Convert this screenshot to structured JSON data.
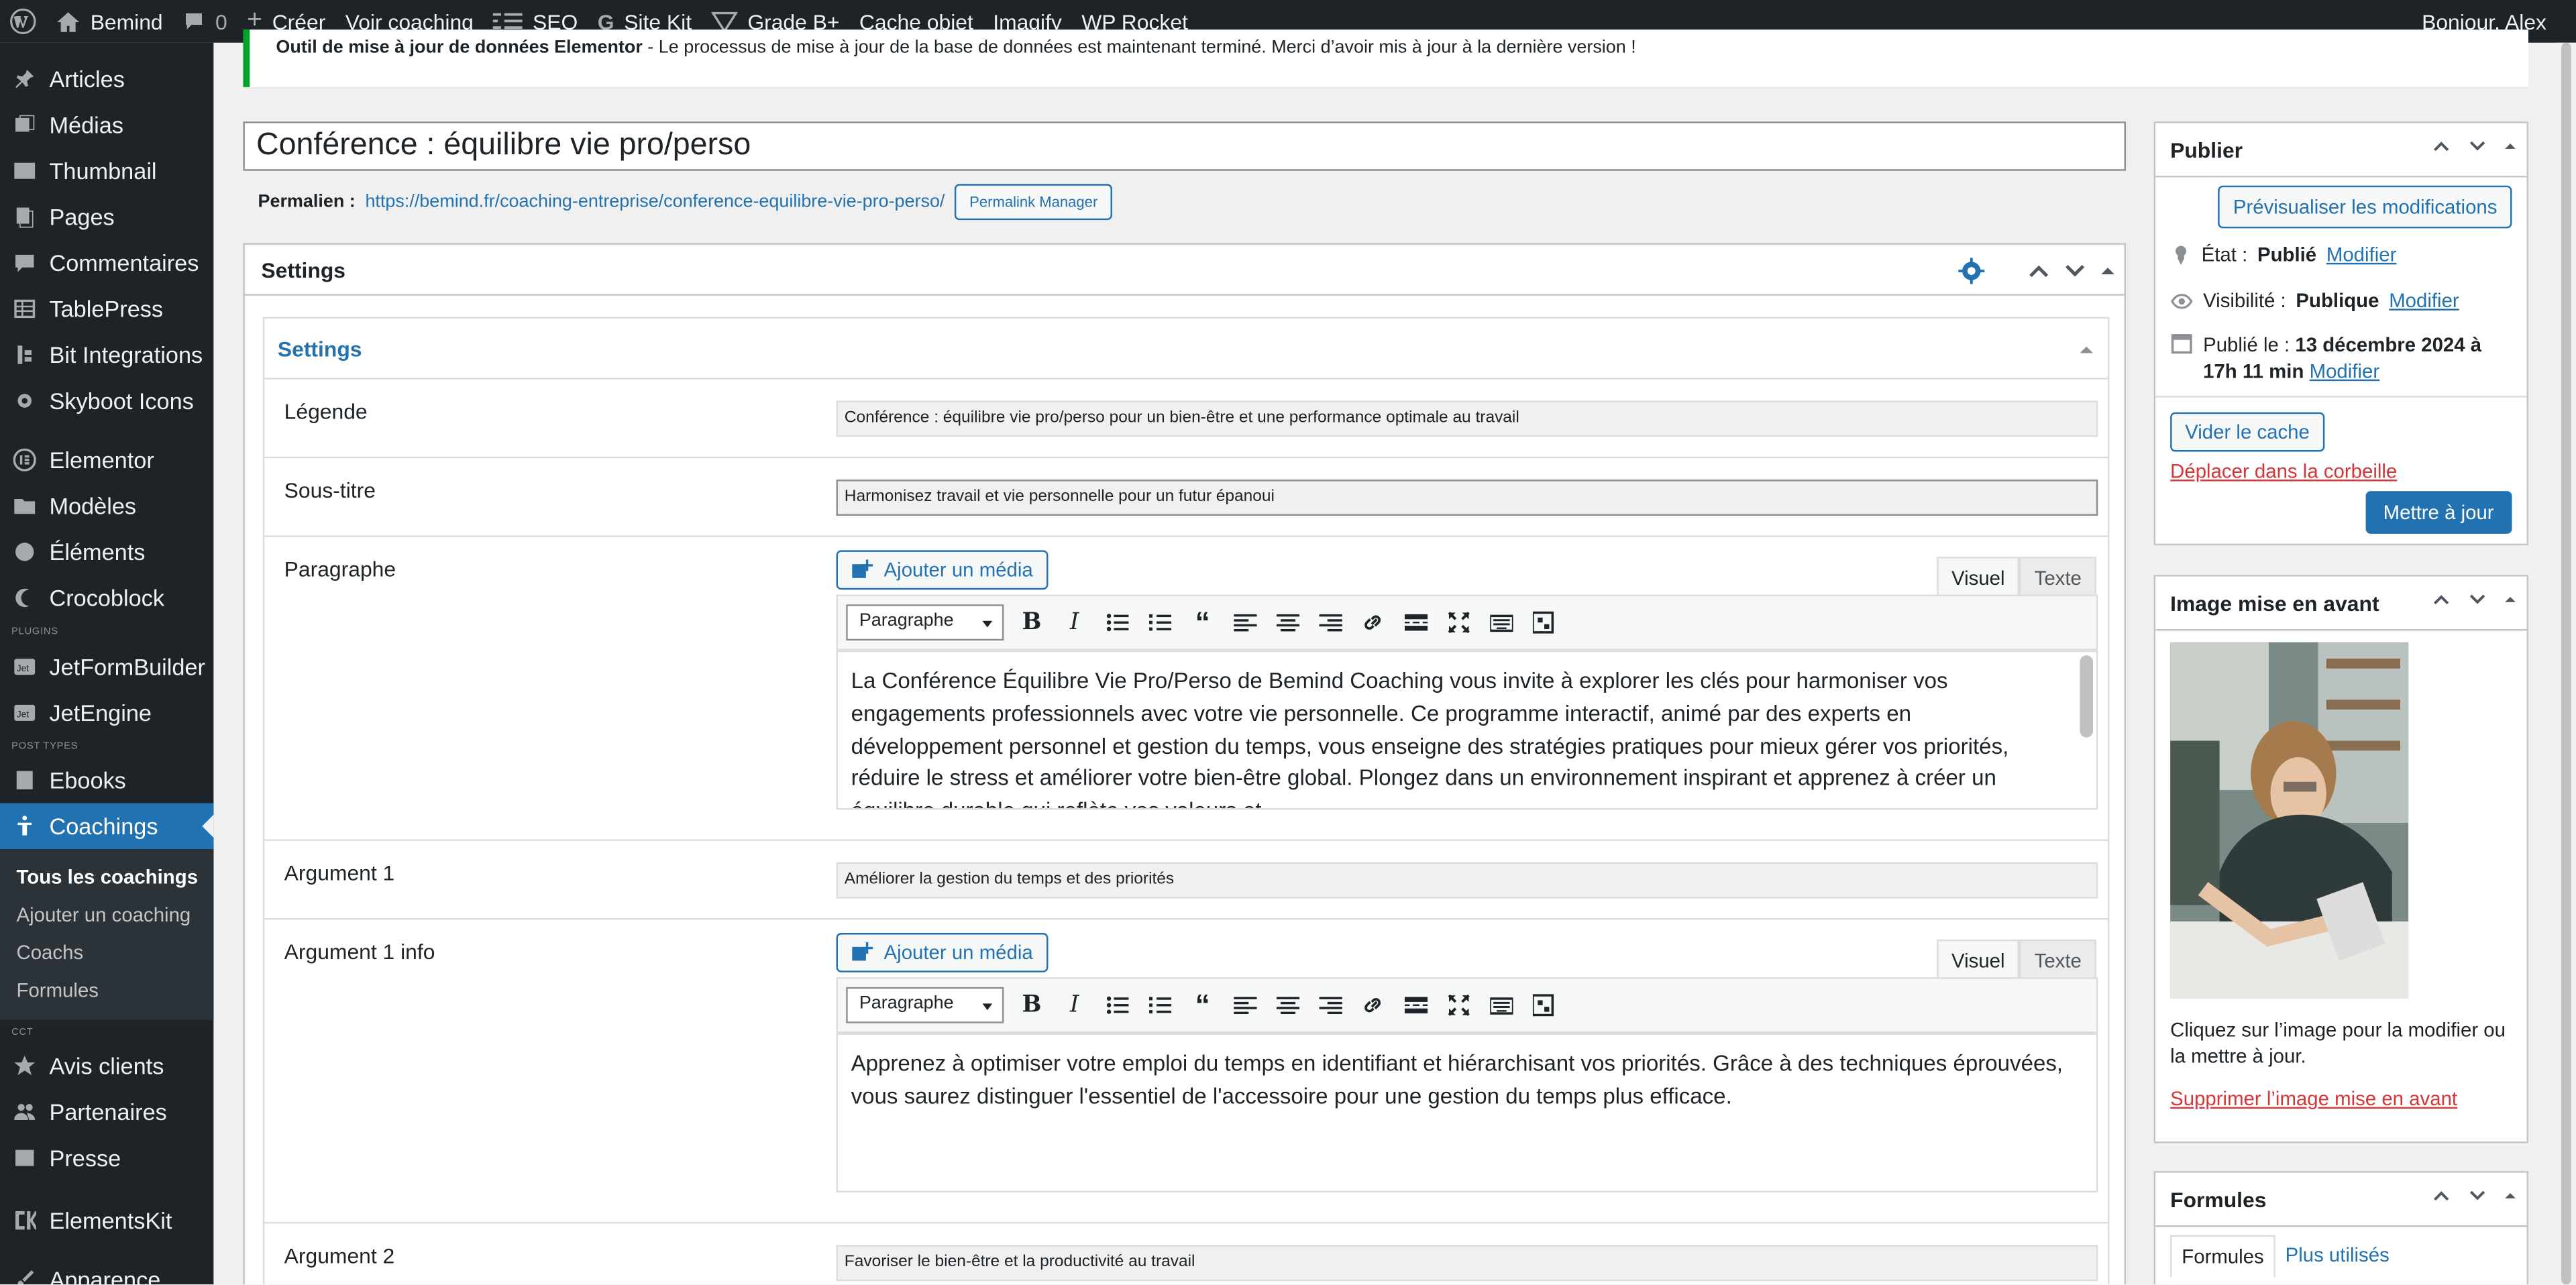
{
  "adminbar": {
    "site_name": "Bemind",
    "comments_count": "0",
    "create": "Créer",
    "view": "Voir coaching",
    "seo": "SEO",
    "sitekit": "Site Kit",
    "gradeb": "Grade B+",
    "cache": "Cache objet",
    "imagify": "Imagify",
    "wprocket": "WP Rocket",
    "greeting": "Bonjour, Alex"
  },
  "sidebar": {
    "items": [
      {
        "label": "Articles",
        "icon": "pin-icon"
      },
      {
        "label": "Médias",
        "icon": "media-icon"
      },
      {
        "label": "Thumbnail",
        "icon": "image-icon"
      },
      {
        "label": "Pages",
        "icon": "pages-icon"
      },
      {
        "label": "Commentaires",
        "icon": "comments-icon"
      },
      {
        "label": "TablePress",
        "icon": "table-icon"
      },
      {
        "label": "Bit Integrations",
        "icon": "integration-icon"
      },
      {
        "label": "Skyboot Icons",
        "icon": "gear-icon"
      },
      {
        "label": "Elementor",
        "icon": "elementor-icon"
      },
      {
        "label": "Modèles",
        "icon": "folder-icon"
      },
      {
        "label": "Éléments",
        "icon": "elements-icon"
      },
      {
        "label": "Crocoblock",
        "icon": "crocoblock-icon"
      },
      {
        "label": "JetFormBuilder",
        "icon": "jet-icon"
      },
      {
        "label": "JetEngine",
        "icon": "jet-icon"
      },
      {
        "label": "Ebooks",
        "icon": "book-icon"
      },
      {
        "label": "Coachings",
        "icon": "coach-icon"
      },
      {
        "label": "Avis clients",
        "icon": "star-icon"
      },
      {
        "label": "Partenaires",
        "icon": "users-icon"
      },
      {
        "label": "Presse",
        "icon": "press-icon"
      },
      {
        "label": "ElementsKit",
        "icon": "ek-icon"
      },
      {
        "label": "Apparence",
        "icon": "brush-icon"
      }
    ],
    "sep_plugins": "PLUGINS",
    "sep_post_types": "POST TYPES",
    "sep_cct": "CCT",
    "submenu": [
      "Tous les coachings",
      "Ajouter un coaching",
      "Coachs",
      "Formules"
    ]
  },
  "notice": {
    "bold": "Outil de mise à jour de données Elementor",
    "text": " - Le processus de mise à jour de la base de données est maintenant terminé. Merci d’avoir mis à jour à la dernière version !"
  },
  "post": {
    "title": "Conférence : équilibre vie pro/perso",
    "permalink_label": "Permalien :",
    "permalink_url": "https://bemind.fr/coaching-entreprise/conference-equilibre-vie-pro-perso/",
    "permalink_manager": "Permalink Manager"
  },
  "settings": {
    "box_title": "Settings",
    "inner_title": "Settings",
    "legende_label": "Légende",
    "legende_value": "Conférence : équilibre vie pro/perso pour un bien-être et une performance optimale au travail",
    "soustitre_label": "Sous-titre",
    "soustitre_value": "Harmonisez travail et vie personnelle pour un futur épanoui",
    "paragraphe_label": "Paragraphe",
    "add_media": "Ajouter un média",
    "tab_visual": "Visuel",
    "tab_text": "Texte",
    "format_select": "Paragraphe",
    "paragraphe_text": "La Conférence Équilibre Vie Pro/Perso de Bemind Coaching vous invite à explorer les clés pour harmoniser vos engagements professionnels avec votre vie personnelle. Ce programme interactif, animé par des experts en développement personnel et gestion du temps, vous enseigne des stratégies pratiques pour mieux gérer vos priorités, réduire le stress et améliorer votre bien-être global. Plongez dans un environnement inspirant et apprenez à créer un équilibre durable qui reflète vos valeurs et",
    "arg1_label": "Argument 1",
    "arg1_value": "Améliorer la gestion du temps et des priorités",
    "arg1info_label": "Argument 1 info",
    "arg1info_text": "Apprenez à optimiser votre emploi du temps en identifiant et hiérarchisant vos priorités. Grâce à des techniques éprouvées, vous saurez distinguer l'essentiel de l'accessoire pour une gestion du temps plus efficace.",
    "arg2_label": "Argument 2",
    "arg2_value": "Favoriser le bien-être et la productivité au travail"
  },
  "publish": {
    "title": "Publier",
    "preview": "Prévisualiser les modifications",
    "status_label": "État :",
    "status_value": "Publié",
    "visibility_label": "Visibilité :",
    "visibility_value": "Publique",
    "modify": "Modifier",
    "published_label": "Publié le :",
    "published_value": "13 décembre 2024 à 17h 11 min",
    "purge_cache": "Vider le cache",
    "trash": "Déplacer dans la corbeille",
    "update": "Mettre à jour"
  },
  "featured": {
    "title": "Image mise en avant",
    "hint": "Cliquez sur l’image pour la modifier ou la mettre à jour.",
    "remove": "Supprimer l’image mise en avant"
  },
  "formules": {
    "title": "Formules",
    "tab_all": "Formules",
    "tab_used": "Plus utilisés"
  }
}
